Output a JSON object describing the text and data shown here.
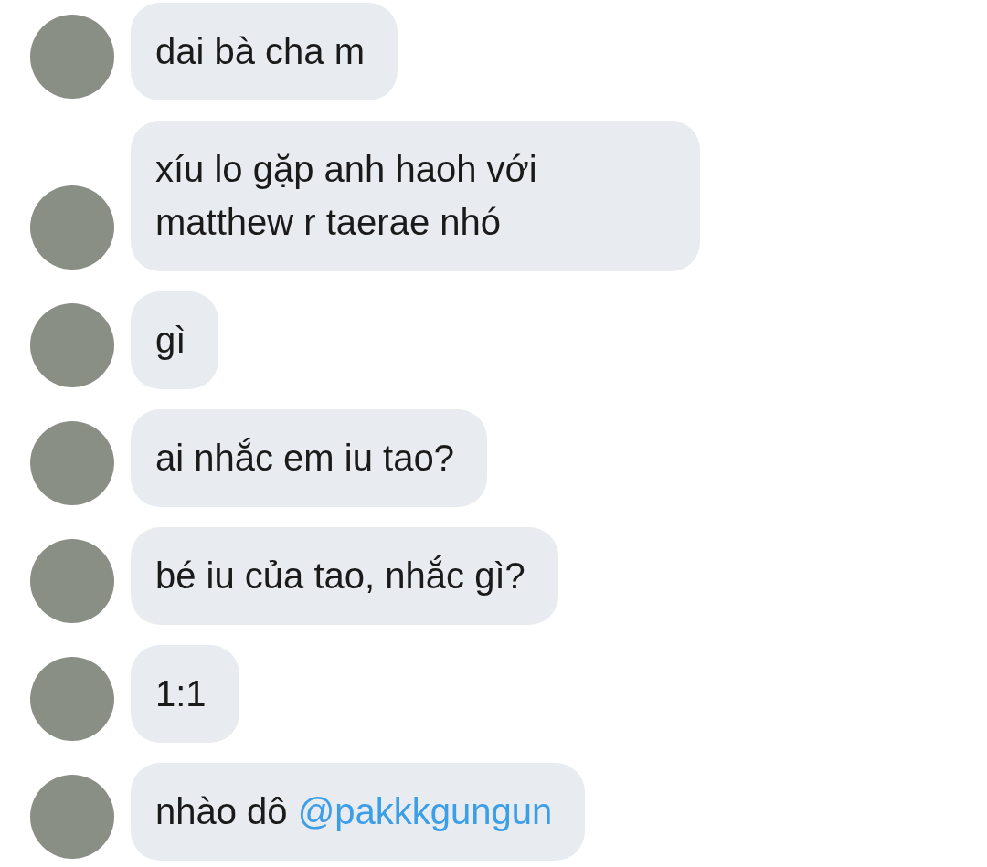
{
  "messages": [
    {
      "parts": [
        {
          "kind": "text",
          "text": "dai bà cha m"
        }
      ]
    },
    {
      "parts": [
        {
          "kind": "text",
          "text": "xíu lo gặp anh haoh với matthew r taerae nhó"
        }
      ]
    },
    {
      "parts": [
        {
          "kind": "text",
          "text": "gì"
        }
      ]
    },
    {
      "parts": [
        {
          "kind": "text",
          "text": "ai nhắc em iu tao?"
        }
      ]
    },
    {
      "parts": [
        {
          "kind": "text",
          "text": "bé iu của tao, nhắc gì?"
        }
      ]
    },
    {
      "parts": [
        {
          "kind": "text",
          "text": "1:1"
        }
      ]
    },
    {
      "parts": [
        {
          "kind": "text",
          "text": "nhào dô "
        },
        {
          "kind": "mention",
          "text": "@pakkkgungun"
        }
      ]
    }
  ]
}
